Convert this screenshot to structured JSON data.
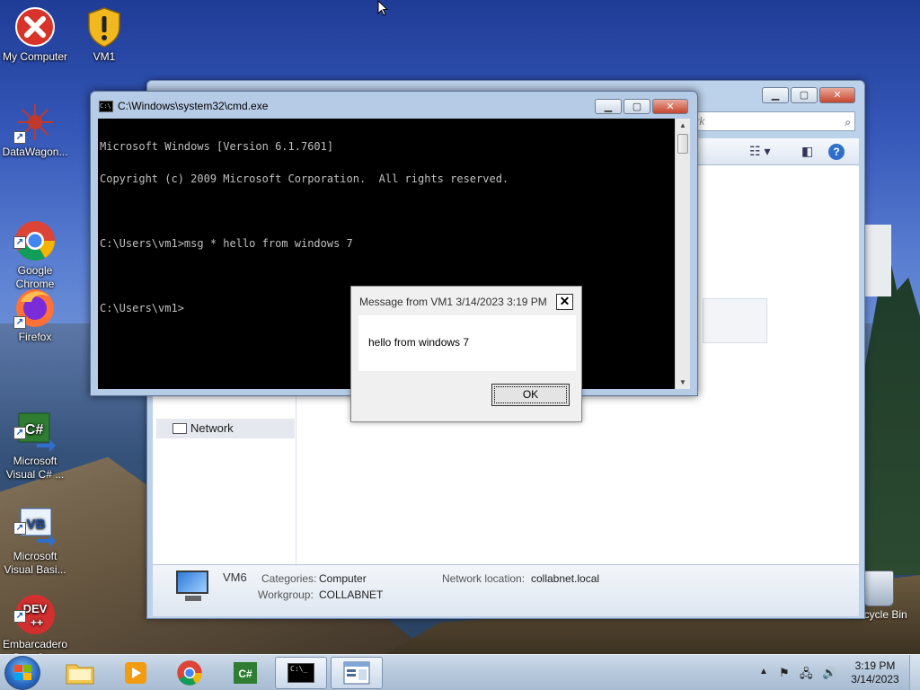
{
  "desktop_icons": [
    {
      "label": "My Computer",
      "icon": "close-circle-icon"
    },
    {
      "label": "VM1",
      "icon": "shield-warning-icon"
    },
    {
      "label": "DataWagon...",
      "icon": "datawagon-icon"
    },
    {
      "label": "Google\nChrome",
      "icon": "chrome-icon"
    },
    {
      "label": "Firefox",
      "icon": "firefox-icon"
    },
    {
      "label": "Microsoft\nVisual C# ...",
      "icon": "visual-csharp-icon"
    },
    {
      "label": "Microsoft\nVisual Basi...",
      "icon": "visual-basic-icon"
    },
    {
      "label": "Embarcadero\nDev-C++",
      "icon": "devcpp-icon"
    },
    {
      "label": "Recycle Bin",
      "icon": "recycle-bin-icon"
    }
  ],
  "explorer": {
    "search_placeholder": "work",
    "nav_network_label": "Network",
    "detail": {
      "name": "VM6",
      "categories_label": "Categories:",
      "categories_value": "Computer",
      "workgroup_label": "Workgroup:",
      "workgroup_value": "COLLABNET",
      "netloc_label": "Network location:",
      "netloc_value": "collabnet.local"
    }
  },
  "cmd": {
    "title": "C:\\Windows\\system32\\cmd.exe",
    "icon_text": "C:\\",
    "lines": [
      "Microsoft Windows [Version 6.1.7601]",
      "Copyright (c) 2009 Microsoft Corporation.  All rights reserved.",
      "",
      "C:\\Users\\vm1>msg * hello from windows 7",
      "",
      "C:\\Users\\vm1>"
    ]
  },
  "msgbox": {
    "title": "Message from VM1 3/14/2023 3:19 PM",
    "close_glyph": "✕",
    "text": "hello from windows 7",
    "ok_label": "OK"
  },
  "taskbar": {
    "buttons": [
      {
        "name": "file-explorer",
        "icon": "folder-icon"
      },
      {
        "name": "media-player",
        "icon": "media-player-icon"
      },
      {
        "name": "chrome",
        "icon": "chrome-icon"
      },
      {
        "name": "visual-csharp",
        "icon": "visual-csharp-icon"
      },
      {
        "name": "cmd",
        "icon": "cmd-icon",
        "icon_text": "C:\\_",
        "active": true
      },
      {
        "name": "network-explorer",
        "icon": "window-icon",
        "active": true
      }
    ],
    "clock_time": "3:19 PM",
    "clock_date": "3/14/2023"
  },
  "colors": {
    "console_bg": "#000000",
    "console_fg": "#c0c0c0",
    "window_frame": "#b6cbe6",
    "close_button": "#c7442e"
  }
}
